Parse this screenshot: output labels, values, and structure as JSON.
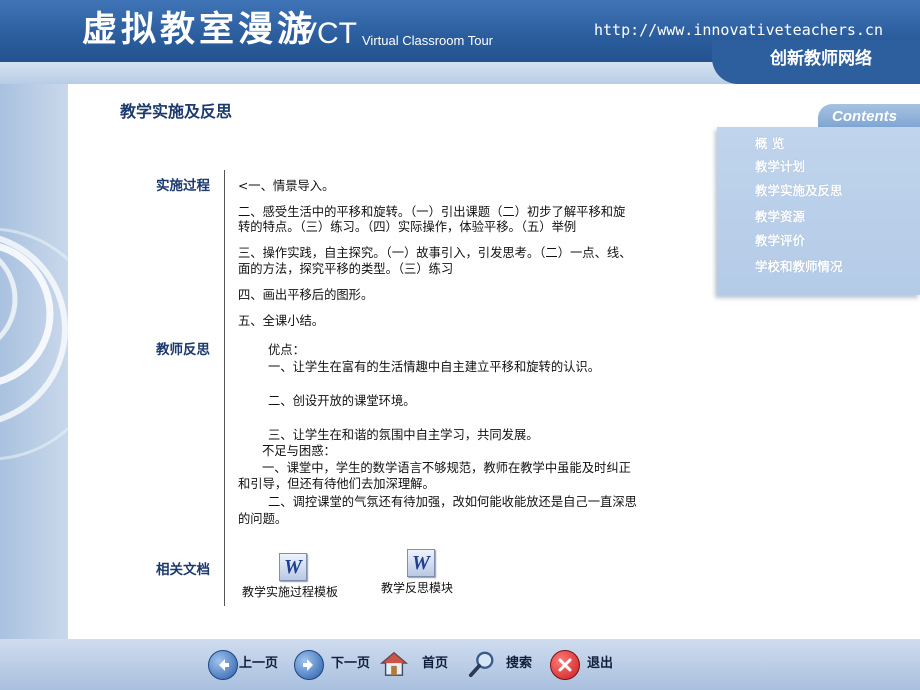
{
  "header": {
    "title": "虚拟教室漫游",
    "abbr": "VCT",
    "subtitle": "Virtual Classroom Tour",
    "url": "http://www.innovativeteachers.cn",
    "network": "创新教师网络"
  },
  "sidebar": {
    "heading": "Contents",
    "items": [
      {
        "label": "概 览"
      },
      {
        "label": "教学计划"
      },
      {
        "label": "教学实施及反思"
      },
      {
        "label": "教学资源"
      },
      {
        "label": "教学评价"
      },
      {
        "label": "学校和教师情况"
      }
    ]
  },
  "main": {
    "page_title": "教学实施及反思",
    "sections": {
      "process": "实施过程",
      "reflection": "教师反思",
      "documents": "相关文档"
    },
    "process_lines": [
      "<一、情景导入。",
      "二、感受生活中的平移和旋转。（一）引出课题（二）初步了解平移和旋",
      "转的特点。（三）练习。（四）实际操作，体验平移。（五）举例",
      "三、操作实践，自主探究。（一）故事引入，引发思考。（二）一点、线、",
      "面的方法，探究平移的类型。（三）练习",
      "四、画出平移后的图形。",
      "五、全课小结。"
    ],
    "reflection_lines": [
      "优点：",
      "一、让学生在富有的生活情趣中自主建立平移和旋转的认识。",
      "二、创设开放的课堂环境。",
      "三、让学生在和谐的氛围中自主学习，共同发展。",
      "不足与困惑：",
      "一、课堂中，学生的数学语言不够规范，教师在教学中虽能及时纠正",
      "和引导，但还有待他们去加深理解。",
      "二、调控课堂的气氛还有待加强，改如何能收能放还是自己一直深思",
      "的问题。"
    ],
    "documents": [
      {
        "label": "教学实施过程模板",
        "icon": "word-document-icon"
      },
      {
        "label": "教学反思模块",
        "icon": "word-document-icon"
      }
    ]
  },
  "footer": {
    "prev": "上一页",
    "next": "下一页",
    "home": "首页",
    "search": "搜索",
    "exit": "退出"
  },
  "colors": {
    "header_blue": "#2b5d9d",
    "title_navy": "#1d3a6e",
    "sidebar_blue": "#b4cbe7",
    "exit_red": "#c81e1e"
  }
}
